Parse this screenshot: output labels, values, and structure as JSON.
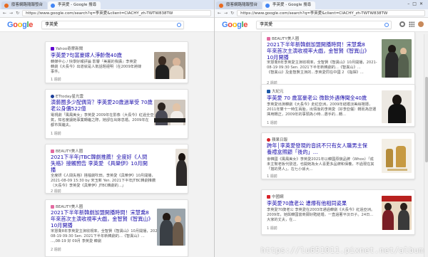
{
  "left": {
    "tabs": [
      {
        "label": "廢客網路隨報發台"
      },
      {
        "label": "李英愛 - Google 搜尋"
      }
    ],
    "url": "https://www.google.com/search?q=李英愛&client=CIACHY_zh-TWTW838TW",
    "search_query": "李英愛",
    "cards": [
      {
        "source": "Yahoo奇摩新聞",
        "title": "李英愛7句富豪嫁人淨齡傷40歲",
        "snippet": [
          "韓媒中心 / 快學好報評論 影響『美麗的我講』李英愛",
          "韓劇《大長今》出道就是人氣話題證明（在2009年將嫁",
          "事件。"
        ],
        "meta": "1 週前"
      },
      {
        "source": "ETtoday星光雲",
        "title": "演藝圈多少配偶背？李英愛20歲過單受 70歲老公身價522億",
        "snippet": [
          "電視劇「風風美女」李英愛 2009年在影像（大長今》紅過全亞洲!人",
          "氣，知名度讓她事業轉繼之際，她卻在出嫁息婚。2009年在",
          "都市與繼夫。"
        ],
        "meta": "1 週前"
      },
      {
        "source": "BEAUTY美人圈",
        "title": "2021下半年JTBC韓劇推薦！全度好《人間失格》接觸預告 李英愛 《具樂伊》10月開播",
        "snippet": [
          "全度妍《人間失格》搭檔劇吹田，李英愛《具樂伊》10月開播，",
          "2021-08-09 15:30 by 宋玉新 Yen. 2021下半年JTBC韓劇推薦",
          "（大長今》李英愛《具樂伊》JTBC韓劇的...」"
        ],
        "meta": "2 週前"
      },
      {
        "source": "BEAUTY美人圈",
        "title": "2021下半年新韓劇加盟開播時間！宋慧喬8年來首次主演收視率大戲，金智賢《智異山》10月開播",
        "snippet": [
          "宋慧喬8年李英愛主演收視率，全智賢《智異山》10月開播，2021-",
          "08-19 09:30 Sen. 2021下半年新韓劇的...《智異山》...",
          "...,08-19 好 09月 李英愛 韓劇"
        ],
        "meta": "2 週前"
      }
    ]
  },
  "right": {
    "tabs": [
      {
        "label": "廢客網路隨報發台"
      },
      {
        "label": "李英愛 - Google 搜尋"
      }
    ],
    "url": "https://www.google.com/search?q=李英愛&client=CIACHY_zh-TWTW838TW",
    "search_query": "李英愛",
    "cards": [
      {
        "source": "BEAUTY美人圈",
        "title": "2021下半年新韓劇加盟開播時間！宋慧喬8年來首次主演收視率大戲，金智賢《智異山》10月開播",
        "snippet": [
          "宋慧喬8年李英愛主演收視率，全智賢《智異山》10月開播，2021-",
          "08-19 09:30 Sen. 2021下半年新韓劇的...《智異山》...",
          "《智異山》及金智賢主演的...李英愛同在中國 2 《指揮》..."
        ],
        "meta": "2 週前"
      },
      {
        "source": "大紀元",
        "title": "李英愛 70 歲富豪老公 微軟外遇傳聞全40歲",
        "snippet": [
          "李英愛出演韓劇《大長今》走紅亞洲，2009年結婚淡美絲場隱，",
          "2011年雙十一時生兩胎，出情後的李英愛（好李亞儷）轉而為您選",
          "擇用轉正，2009年的事頭為小時...選手的...轉..."
        ],
        "meta": "1 週前"
      },
      {
        "source": "蘋果日報",
        "title": "跨年│李英愛發現的音訊不只有女人職男主保養禮盒照顧「後的」...",
        "snippet": [
          "會韓國《風風美女》李英愛2021年以韓國原貌品牌（Whoo）「成",
          "未主幫老板代發送，也開她為女人喜更多品牌和保養，不過現在其",
          "「搭的男人」，在七小孫大..."
        ],
        "meta": "1 週前"
      },
      {
        "source": "中國網",
        "title": "李英愛70歲老公 遭爆有他相同姿果",
        "snippet": [
          "李英愛70歲老公 李英愛在2003年通過韓劇《大長今》紅過亞洲。",
          "2009年，她與韓國富商鄭好甦結婚，一直過著平淡日子。24日...",
          "大家的丈夫，在..."
        ],
        "meta": "1 週前"
      }
    ]
  },
  "colors": {
    "blue": "#4285f4",
    "red": "#ea4335",
    "yellow": "#fbbc05",
    "green": "#34a853",
    "link": "#1a0dab"
  },
  "watermark": "https://lu651011.pixnet.net/album"
}
